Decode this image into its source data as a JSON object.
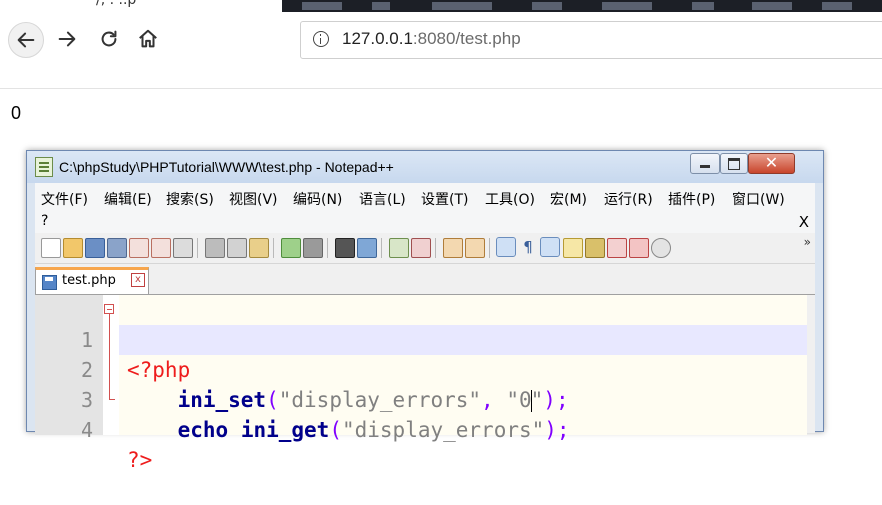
{
  "browser": {
    "tab_fragment": "/, . ..p",
    "url_host": "127.0.0.1",
    "url_rest": ":8080/test.php",
    "page_output": "0"
  },
  "notepad": {
    "title": "C:\\phpStudy\\PHPTutorial\\WWW\\test.php - Notepad++",
    "menu": [
      "文件(F)",
      "编辑(E)",
      "搜索(S)",
      "视图(V)",
      "编码(N)",
      "语言(L)",
      "设置(T)",
      "工具(O)",
      "宏(M)",
      "运行(R)",
      "插件(P)",
      "窗口(W)"
    ],
    "menu_help": "?",
    "menu_close": "X",
    "toolbar_overflow": "»",
    "file_tab": "test.php",
    "file_tab_close": "x",
    "lines": [
      {
        "num": "1"
      },
      {
        "num": "2"
      },
      {
        "num": "3"
      },
      {
        "num": "4"
      }
    ],
    "code": {
      "l1_open": "<?php",
      "l2_fn": "ini_set",
      "l2_lp": "(",
      "l2_s1": "\"display_errors\"",
      "l2_comma": ", ",
      "l2_s2a": "\"0",
      "l2_s2b": "\"",
      "l2_end": ");",
      "l3_echo": "echo",
      "l3_fn": "ini_get",
      "l3_lp": "(",
      "l3_s1": "\"display_errors\"",
      "l3_end": ");",
      "l4_close": "?>"
    },
    "colors": {
      "php_tag": "#ee1c1c",
      "function": "#00008b",
      "string": "#808080",
      "operator": "#8000ff",
      "current_line": "#e8e8ff"
    }
  }
}
